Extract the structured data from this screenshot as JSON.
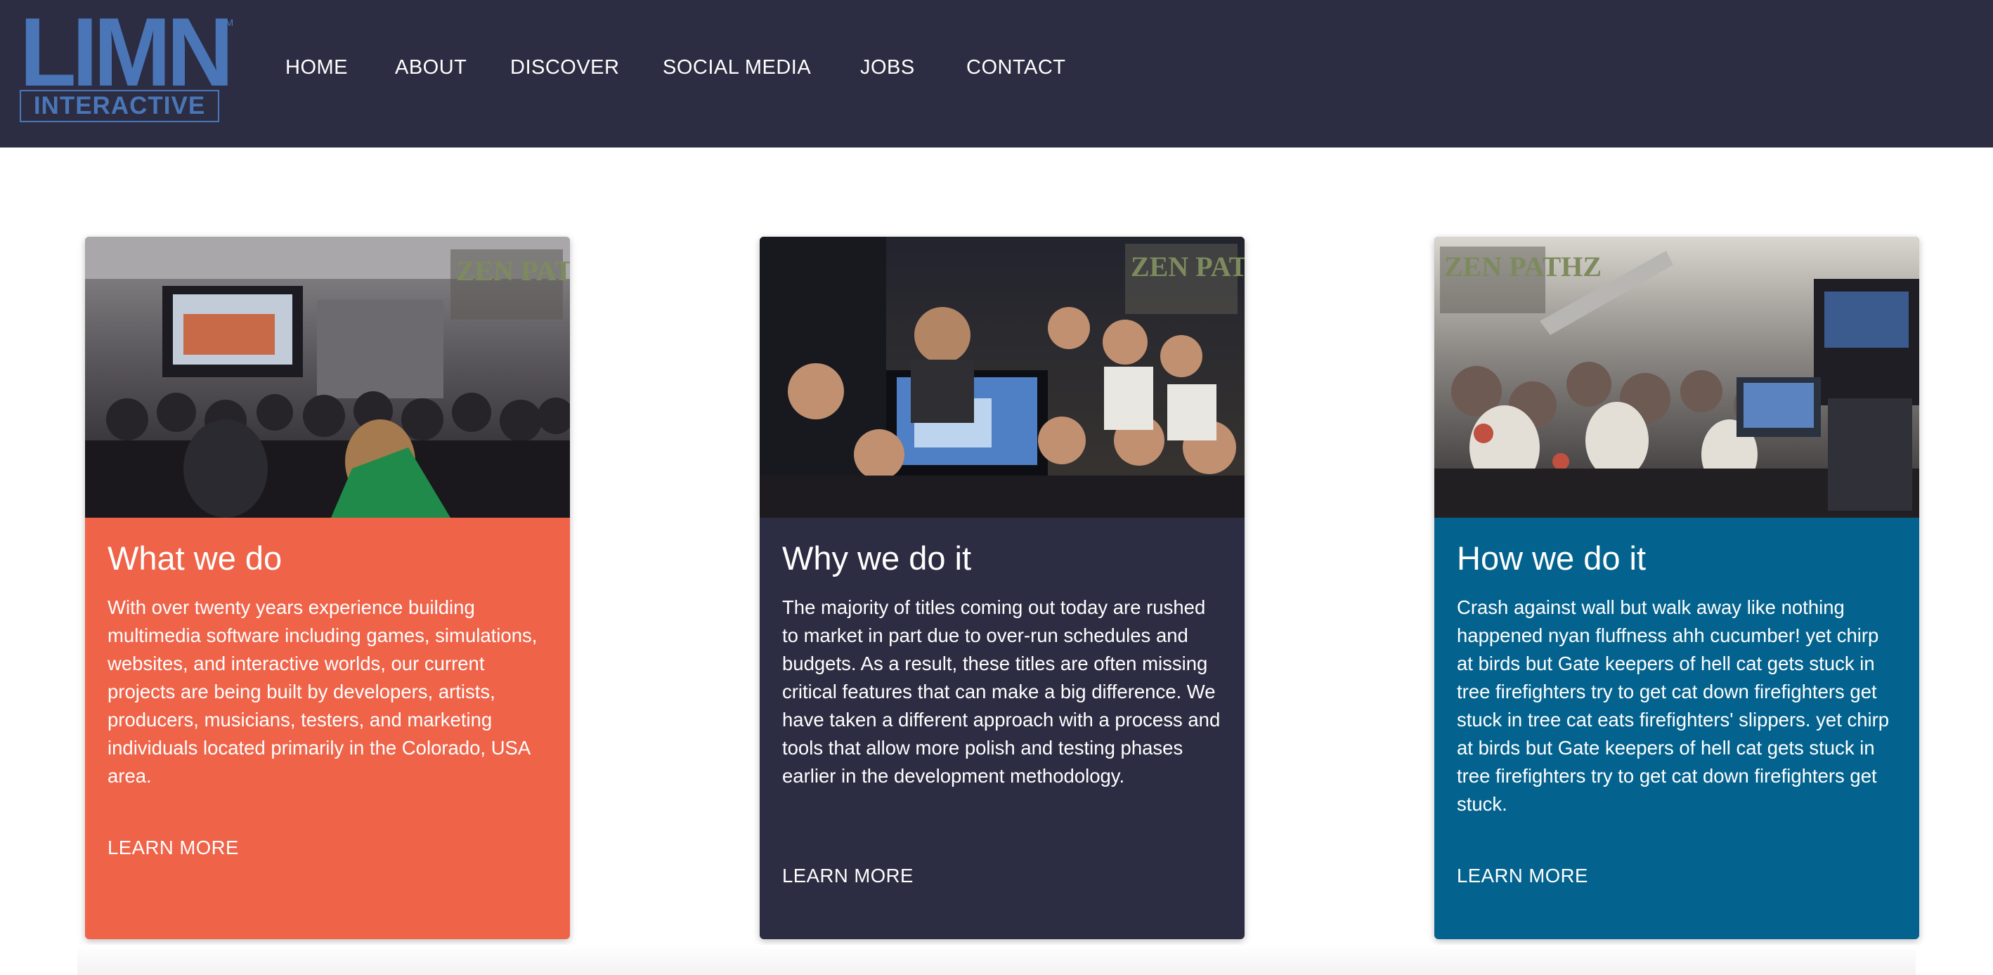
{
  "logo": {
    "top_text": "LIMN",
    "bottom_text": "INTERACTIVE",
    "trademark": "TM",
    "color": "#4a76b8"
  },
  "nav": {
    "items": [
      {
        "label": "HOME"
      },
      {
        "label": "ABOUT"
      },
      {
        "label": "DISCOVER"
      },
      {
        "label": "SOCIAL MEDIA"
      },
      {
        "label": "JOBS"
      },
      {
        "label": "CONTACT"
      }
    ]
  },
  "colors": {
    "header_bg": "#2c2d42",
    "card_orange": "#ef6349",
    "card_navy": "#2c2d42",
    "card_blue": "#04638e"
  },
  "cards": [
    {
      "image": "convention-theater-audience-photo",
      "image_watermark": "ZEN PATHZ",
      "title": "What we do",
      "body": "With over twenty years experience building multimedia software including games, simulations, websites, and interactive worlds, our current projects are being built by developers, artists, producers, musicians, testers, and marketing individuals located primarily in the Colorado, USA area.",
      "link": "LEARN MORE"
    },
    {
      "image": "convention-booth-thumbs-up-photo",
      "image_watermark": "ZEN PATHZ",
      "title": "Why we do it",
      "body": "The majority of titles coming out today are rushed to market in part due to over-run schedules and budgets. As a result, these titles are often missing critical features that can make a big difference. We have taken a different approach with a process and tools that allow more polish and testing phases earlier in the development methodology.",
      "link": "LEARN MORE"
    },
    {
      "image": "convention-costume-crowd-photo",
      "image_watermark": "ZEN PATHZ",
      "title": "How we do it",
      "body": "Crash against wall but walk away like nothing happened nyan fluffness ahh cucumber! yet chirp at birds but Gate keepers of hell cat gets stuck in tree firefighters try to get cat down firefighters get stuck in tree cat eats firefighters' slippers. yet chirp at birds but Gate keepers of hell cat gets stuck in tree firefighters try to get cat down firefighters get stuck.",
      "link": "LEARN MORE"
    }
  ]
}
